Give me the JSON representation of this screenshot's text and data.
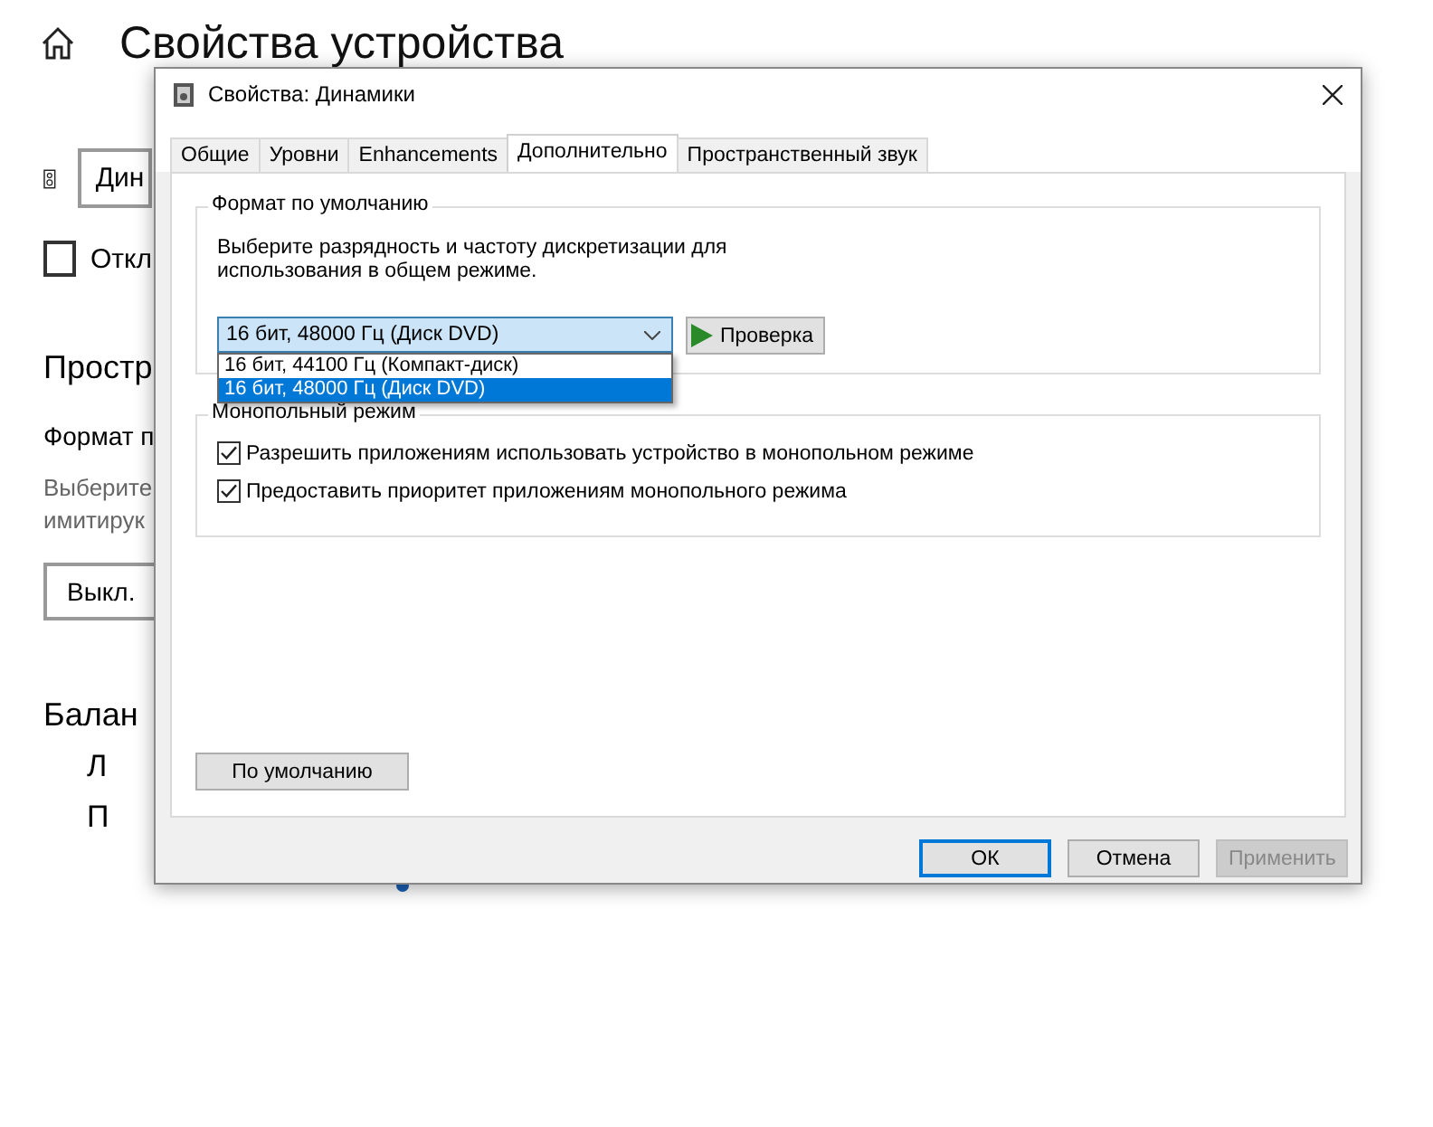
{
  "settings_page": {
    "title": "Свойства устройства",
    "device_field": "Дин",
    "disable_checkbox": {
      "label": "Откл",
      "checked": false
    },
    "spatial_heading": "Простр",
    "format_label": "Формат п",
    "description_lines": [
      "Выберите",
      "имитирук"
    ],
    "spatial_field": "Выкл.",
    "balance_heading": "Балан",
    "balance_channels": [
      "Л",
      "П"
    ]
  },
  "dialog": {
    "title": "Свойства: Динамики",
    "tabs": [
      {
        "label": "Общие",
        "selected": false
      },
      {
        "label": "Уровни",
        "selected": false
      },
      {
        "label": "Enhancements",
        "selected": false
      },
      {
        "label": "Дополнительно",
        "selected": true
      },
      {
        "label": "Пространственный звук",
        "selected": false
      }
    ],
    "default_format": {
      "heading": "Формат по умолчанию",
      "description": "Выберите разрядность и частоту дискретизации для\nиспользования в общем режиме.",
      "combo_value": "16 бит, 48000 Гц (Диск DVD)",
      "test_button": "Проверка",
      "options": [
        {
          "label": "16 бит, 44100 Гц (Компакт-диск)",
          "selected": false
        },
        {
          "label": "16 бит, 48000 Гц (Диск DVD)",
          "selected": true
        }
      ]
    },
    "exclusive_mode": {
      "heading": "Монопольный режим",
      "options": [
        {
          "label": "Разрешить приложениям использовать устройство в монопольном режиме",
          "checked": true
        },
        {
          "label": "Предоставить приоритет приложениям монопольного режима",
          "checked": true
        }
      ]
    },
    "restore_button": "По умолчанию",
    "buttons": [
      {
        "label": "ОК",
        "kind": "default",
        "disabled": false
      },
      {
        "label": "Отмена",
        "kind": "normal",
        "disabled": false
      },
      {
        "label": "Применить",
        "kind": "normal",
        "disabled": true
      }
    ]
  }
}
